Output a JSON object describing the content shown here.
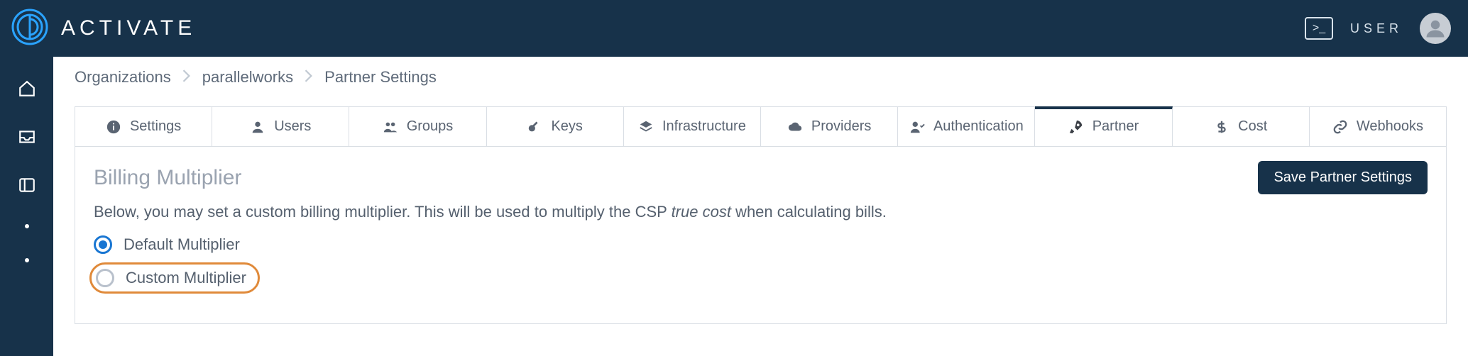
{
  "brand": {
    "name": "ACTIVATE"
  },
  "topbar": {
    "terminal_glyph": ">_",
    "user_label": "USER"
  },
  "breadcrumb": {
    "items": [
      "Organizations",
      "parallelworks",
      "Partner Settings"
    ]
  },
  "tabs": {
    "settings": {
      "label": "Settings"
    },
    "users": {
      "label": "Users"
    },
    "groups": {
      "label": "Groups"
    },
    "keys": {
      "label": "Keys"
    },
    "infrastructure": {
      "label": "Infrastructure"
    },
    "providers": {
      "label": "Providers"
    },
    "authentication": {
      "label": "Authentication"
    },
    "partner": {
      "label": "Partner"
    },
    "cost": {
      "label": "Cost"
    },
    "webhooks": {
      "label": "Webhooks"
    }
  },
  "panel": {
    "title": "Billing Multiplier",
    "save_label": "Save Partner Settings",
    "desc_prefix": "Below, you may set a custom billing multiplier. This will be used to multiply the CSP ",
    "desc_em": "true cost",
    "desc_suffix": " when calculating bills.",
    "option_default": "Default Multiplier",
    "option_custom": "Custom Multiplier"
  }
}
